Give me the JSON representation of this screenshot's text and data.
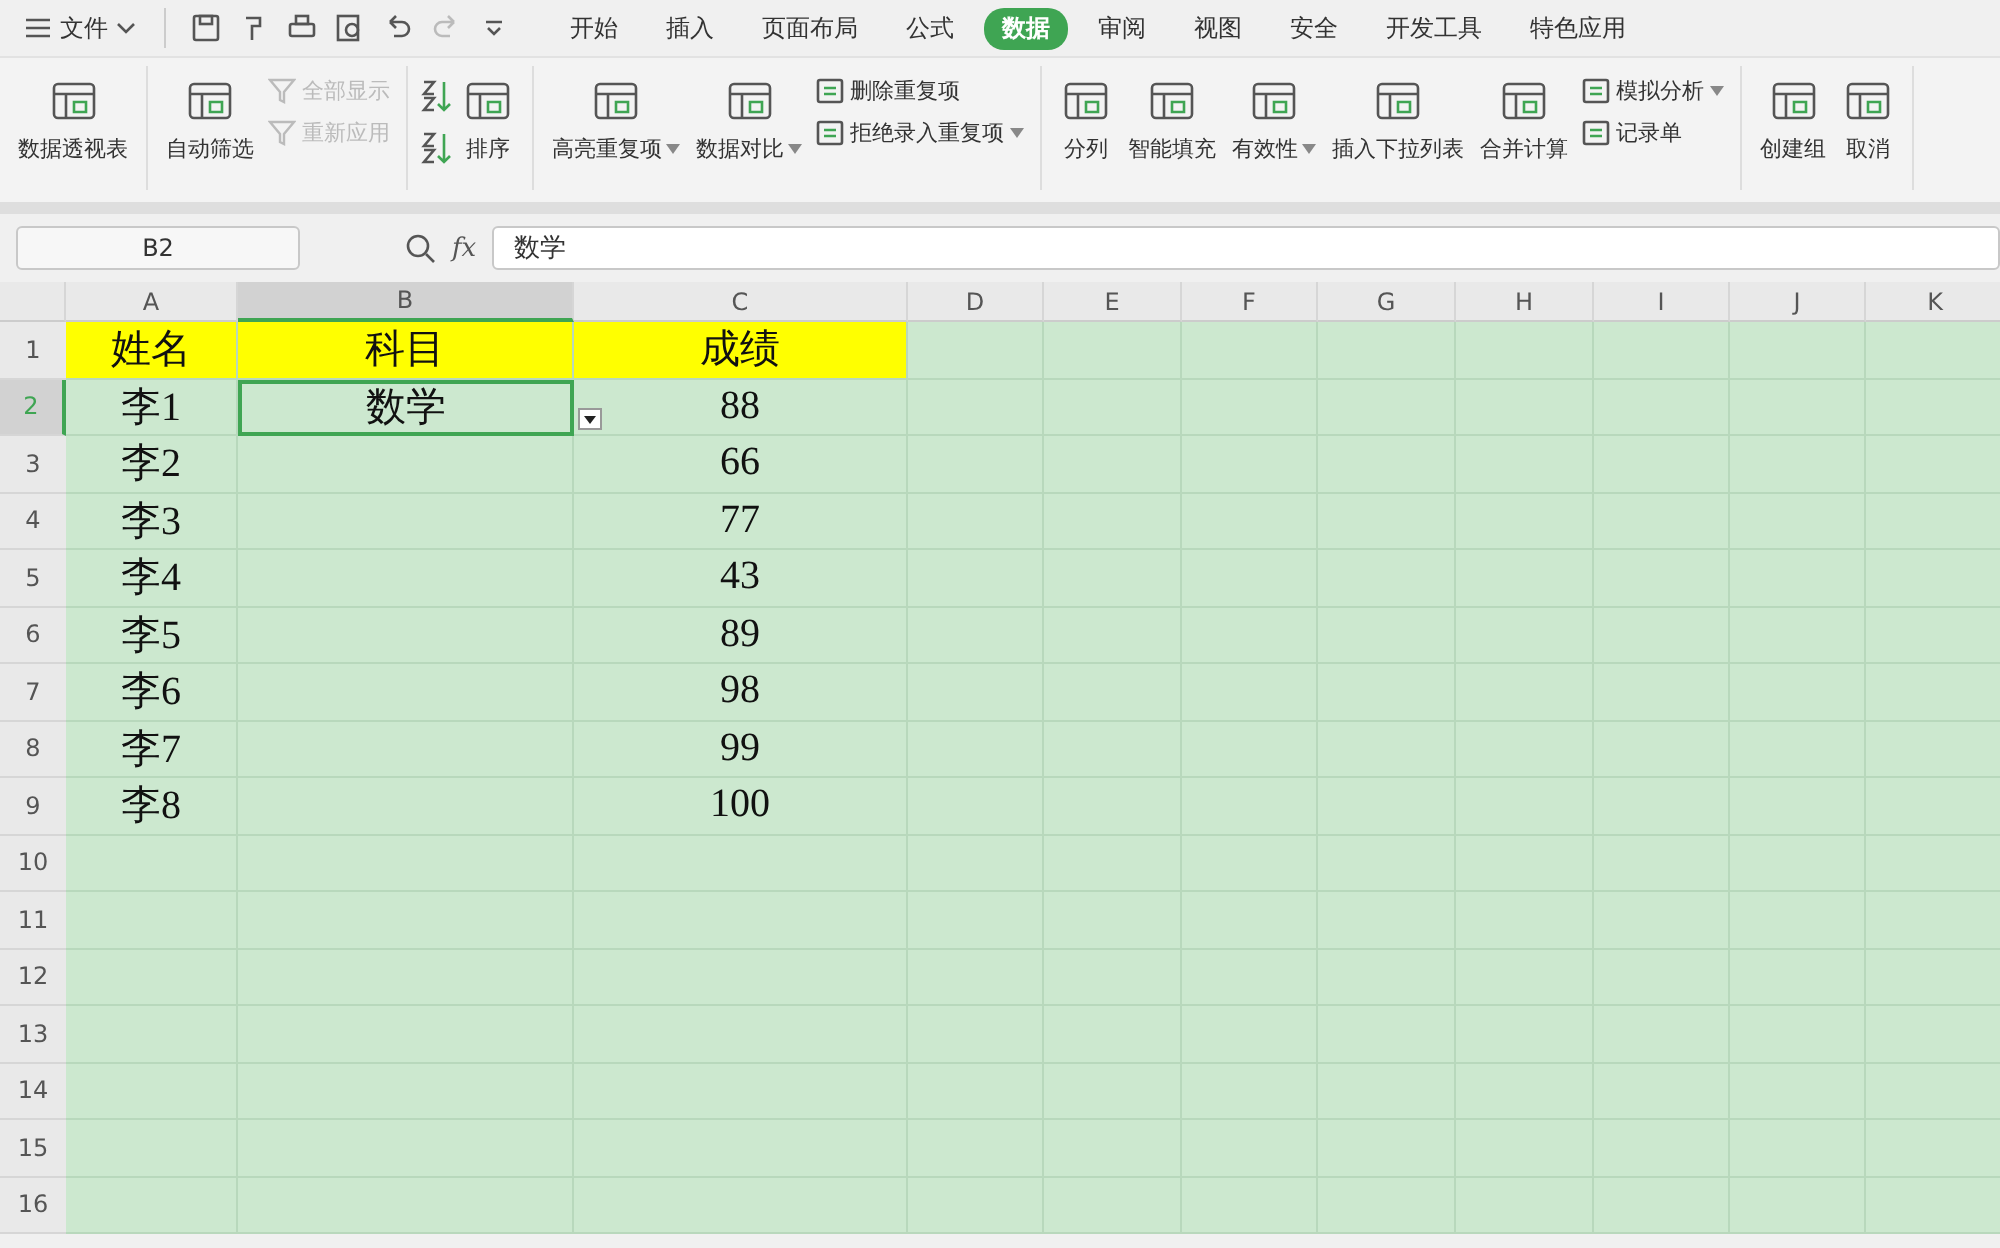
{
  "menu_bar": {
    "file_menu": "文件",
    "tabs": [
      {
        "label": "开始",
        "selected": false
      },
      {
        "label": "插入",
        "selected": false
      },
      {
        "label": "页面布局",
        "selected": false
      },
      {
        "label": "公式",
        "selected": false
      },
      {
        "label": "数据",
        "selected": true
      },
      {
        "label": "审阅",
        "selected": false
      },
      {
        "label": "视图",
        "selected": false
      },
      {
        "label": "安全",
        "selected": false
      },
      {
        "label": "开发工具",
        "selected": false
      },
      {
        "label": "特色应用",
        "selected": false
      }
    ]
  },
  "ribbon": {
    "groups": [
      {
        "items": [
          {
            "kind": "large",
            "label": "数据透视表"
          }
        ]
      },
      {
        "items": [
          {
            "kind": "large",
            "label": "自动筛选"
          },
          {
            "kind": "stack",
            "items": [
              {
                "label": "全部显示",
                "disabled": true,
                "dropdown": false
              },
              {
                "label": "重新应用",
                "disabled": true,
                "dropdown": false
              }
            ]
          }
        ]
      },
      {
        "items": [
          {
            "kind": "sorticons"
          },
          {
            "kind": "large",
            "label": "排序"
          }
        ]
      },
      {
        "items": [
          {
            "kind": "large",
            "label": "高亮重复项",
            "dropdown": true
          },
          {
            "kind": "large",
            "label": "数据对比",
            "dropdown": true
          },
          {
            "kind": "stack",
            "items": [
              {
                "label": "删除重复项",
                "disabled": false,
                "dropdown": false
              },
              {
                "label": "拒绝录入重复项",
                "disabled": false,
                "dropdown": true
              }
            ]
          }
        ]
      },
      {
        "items": [
          {
            "kind": "large",
            "label": "分列"
          },
          {
            "kind": "large",
            "label": "智能填充"
          },
          {
            "kind": "large",
            "label": "有效性",
            "dropdown": true
          },
          {
            "kind": "large",
            "label": "插入下拉列表"
          },
          {
            "kind": "large",
            "label": "合并计算"
          },
          {
            "kind": "stack",
            "items": [
              {
                "label": "模拟分析",
                "disabled": false,
                "dropdown": true
              },
              {
                "label": "记录单",
                "disabled": false,
                "dropdown": false
              }
            ]
          }
        ]
      },
      {
        "items": [
          {
            "kind": "large",
            "label": "创建组"
          },
          {
            "kind": "large",
            "label": "取消"
          }
        ]
      }
    ]
  },
  "formula_bar": {
    "name_box": "B2",
    "fx": "fx",
    "value": "数学"
  },
  "sheet": {
    "columns": [
      {
        "label": "A",
        "selected": false
      },
      {
        "label": "B",
        "selected": true
      },
      {
        "label": "C",
        "selected": false
      },
      {
        "label": "D",
        "selected": false
      },
      {
        "label": "E",
        "selected": false
      },
      {
        "label": "F",
        "selected": false
      },
      {
        "label": "G",
        "selected": false
      },
      {
        "label": "H",
        "selected": false
      },
      {
        "label": "I",
        "selected": false
      },
      {
        "label": "J",
        "selected": false
      },
      {
        "label": "K",
        "selected": false
      }
    ],
    "rows": [
      {
        "number": "1",
        "selected": false,
        "highlighted": true,
        "cells": [
          "姓名",
          "科目",
          "成绩"
        ]
      },
      {
        "number": "2",
        "selected": true,
        "highlighted": false,
        "cells": [
          "李1",
          "数学",
          "88"
        ]
      },
      {
        "number": "3",
        "selected": false,
        "highlighted": false,
        "cells": [
          "李2",
          "",
          "66"
        ]
      },
      {
        "number": "4",
        "selected": false,
        "highlighted": false,
        "cells": [
          "李3",
          "",
          "77"
        ]
      },
      {
        "number": "5",
        "selected": false,
        "highlighted": false,
        "cells": [
          "李4",
          "",
          "43"
        ]
      },
      {
        "number": "6",
        "selected": false,
        "highlighted": false,
        "cells": [
          "李5",
          "",
          "89"
        ]
      },
      {
        "number": "7",
        "selected": false,
        "highlighted": false,
        "cells": [
          "李6",
          "",
          "98"
        ]
      },
      {
        "number": "8",
        "selected": false,
        "highlighted": false,
        "cells": [
          "李7",
          "",
          "99"
        ]
      },
      {
        "number": "9",
        "selected": false,
        "highlighted": false,
        "cells": [
          "李8",
          "",
          "100"
        ]
      },
      {
        "number": "10",
        "selected": false,
        "highlighted": false,
        "cells": []
      },
      {
        "number": "11",
        "selected": false,
        "highlighted": false,
        "cells": []
      },
      {
        "number": "12",
        "selected": false,
        "highlighted": false,
        "cells": []
      },
      {
        "number": "13",
        "selected": false,
        "highlighted": false,
        "cells": []
      },
      {
        "number": "14",
        "selected": false,
        "highlighted": false,
        "cells": []
      },
      {
        "number": "15",
        "selected": false,
        "highlighted": false,
        "cells": []
      },
      {
        "number": "16",
        "selected": false,
        "highlighted": false,
        "cells": []
      }
    ]
  }
}
